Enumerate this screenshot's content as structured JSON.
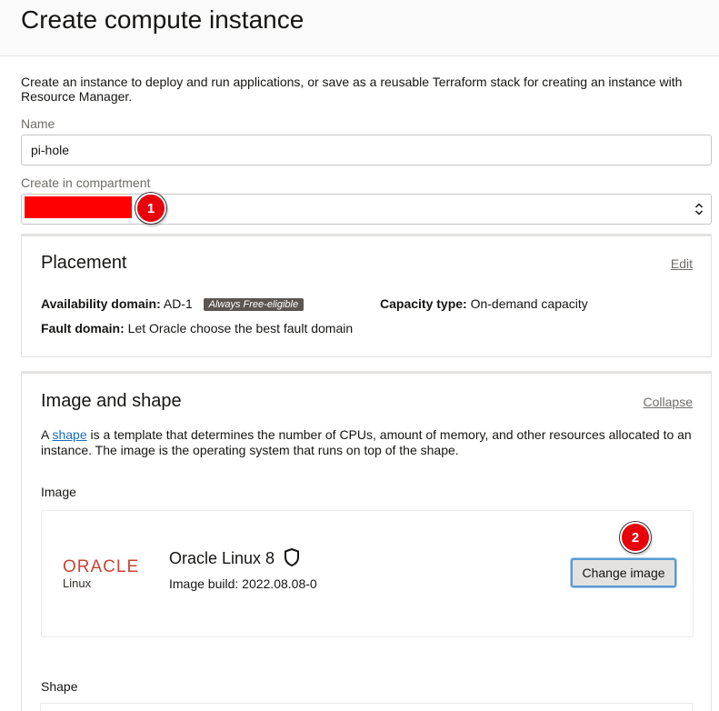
{
  "header": {
    "title": "Create compute instance"
  },
  "intro": "Create an instance to deploy and run applications, or save as a reusable Terraform stack for creating an instance with Resource Manager.",
  "name_field": {
    "label": "Name",
    "value": "pi-hole"
  },
  "compartment_field": {
    "label": "Create in compartment",
    "icon": "sort-icon"
  },
  "badges": {
    "first": "1",
    "second": "2"
  },
  "placement": {
    "title": "Placement",
    "edit_label": "Edit",
    "availability_label": "Availability domain:",
    "availability_value": "AD-1",
    "free_tag": "Always Free-eligible",
    "capacity_label": "Capacity type:",
    "capacity_value": "On-demand capacity",
    "fault_label": "Fault domain:",
    "fault_value": "Let Oracle choose the best fault domain"
  },
  "image_shape": {
    "title": "Image and shape",
    "collapse_label": "Collapse",
    "desc_prefix": "A",
    "desc_link": "shape",
    "desc_rest": "is a template that determines the number of CPUs, amount of memory, and other resources allocated to an instance. The image is the operating system that runs on top of the shape.",
    "image_label": "Image",
    "logo_word": "ORACLE",
    "logo_sub": "Linux",
    "image_name": "Oracle Linux 8",
    "image_build": "Image build: 2022.08.08-0",
    "change_button": "Change image",
    "shape_label": "Shape"
  },
  "colors": {
    "brand": "#c74634",
    "link": "#1a6bbd",
    "badge": "#e8000b",
    "redaction": "#ff0000"
  }
}
